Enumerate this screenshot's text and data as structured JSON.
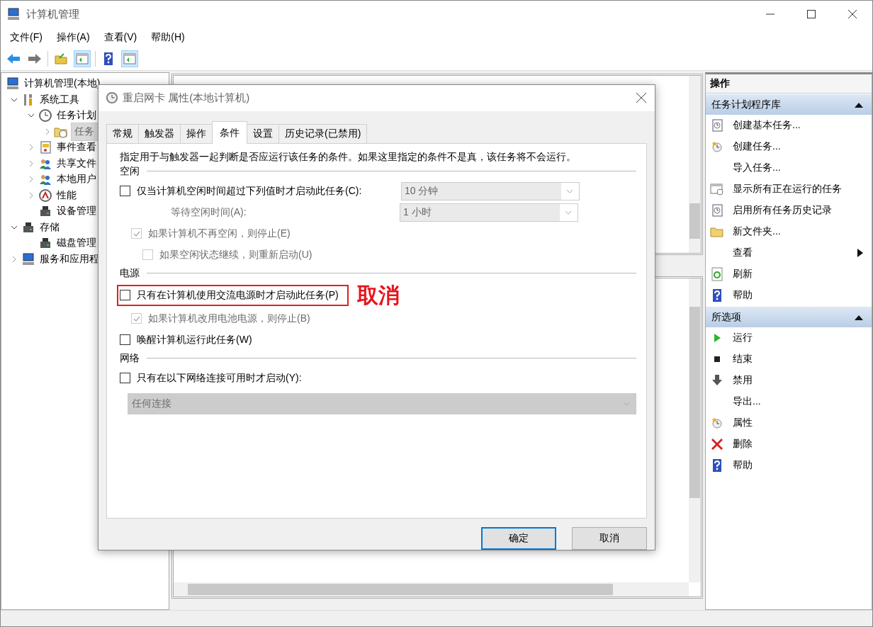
{
  "window": {
    "title": "计算机管理"
  },
  "menu": [
    "文件(F)",
    "操作(A)",
    "查看(V)",
    "帮助(H)"
  ],
  "toolbar": [
    {
      "on": false
    },
    {
      "on": false
    },
    {
      "on": false
    },
    {
      "on": true
    },
    {
      "on": false
    },
    {
      "on": true
    }
  ],
  "tree": [
    {
      "label": "计算机管理(本地)",
      "selected": false,
      "children": [
        {
          "label": "系统工具",
          "selected": false,
          "expanded": true,
          "children": [
            {
              "label": "任务计划",
              "selected": false,
              "expanded": true,
              "children": [
                {
                  "label": "任务",
                  "selected": true,
                  "expanded": false
                }
              ]
            },
            {
              "label": "事件查看",
              "selected": false,
              "expanded": false
            },
            {
              "label": "共享文件",
              "selected": false,
              "expanded": false
            },
            {
              "label": "本地用户",
              "selected": false,
              "expanded": false
            },
            {
              "label": "性能",
              "selected": false,
              "expanded": false
            },
            {
              "label": "设备管理",
              "selected": false
            }
          ]
        },
        {
          "label": "存储",
          "selected": false,
          "expanded": true,
          "children": [
            {
              "label": "磁盘管理",
              "selected": false
            }
          ]
        },
        {
          "label": "服务和应用程",
          "selected": false,
          "expanded": false
        }
      ]
    }
  ],
  "actions": {
    "title": "操作",
    "sections": [
      {
        "title": "任务计划程序库",
        "expanded": true,
        "items": [
          {
            "label": "创建基本任务...",
            "submenu": false
          },
          {
            "label": "创建任务...",
            "submenu": false
          },
          {
            "label": "导入任务...",
            "submenu": false
          },
          {
            "label": "显示所有正在运行的任务",
            "submenu": false
          },
          {
            "label": "启用所有任务历史记录",
            "submenu": false
          },
          {
            "label": "新文件夹...",
            "submenu": false
          },
          {
            "label": "查看",
            "submenu": true
          },
          {
            "label": "刷新",
            "submenu": false
          },
          {
            "label": "帮助",
            "submenu": false
          }
        ]
      },
      {
        "title": "所选项",
        "expanded": true,
        "items": [
          {
            "label": "运行",
            "submenu": false
          },
          {
            "label": "结束",
            "submenu": false
          },
          {
            "label": "禁用",
            "submenu": false
          },
          {
            "label": "导出...",
            "submenu": false
          },
          {
            "label": "属性",
            "submenu": false
          },
          {
            "label": "删除",
            "submenu": false
          },
          {
            "label": "帮助",
            "submenu": false
          }
        ]
      }
    ]
  },
  "dialog": {
    "title": "重启网卡 属性(本地计算机)",
    "tabs": [
      {
        "label": "常规",
        "selected": false
      },
      {
        "label": "触发器",
        "selected": false
      },
      {
        "label": "操作",
        "selected": false
      },
      {
        "label": "条件",
        "selected": true
      },
      {
        "label": "设置",
        "selected": false
      },
      {
        "label": "历史记录(已禁用)",
        "selected": false
      }
    ],
    "description": "指定用于与触发器一起判断是否应运行该任务的条件。如果这里指定的条件不是真，该任务将不会运行。",
    "groups": [
      {
        "heading": "空闲",
        "items": [
          {
            "kind": "checkbox",
            "label": "仅当计算机空闲时间超过下列值时才启动此任务(C):",
            "checked": false,
            "disabled": false,
            "highlighted": false,
            "select": "10 分钟",
            "children": [
              {
                "kind": "label",
                "label": "等待空闲时间(A):",
                "disabled": true,
                "select": "1 小时"
              },
              {
                "kind": "checkbox",
                "label": "如果计算机不再空闲，则停止(E)",
                "checked": true,
                "disabled": true,
                "highlighted": false,
                "children": [
                  {
                    "kind": "checkbox",
                    "label": "如果空闲状态继续，则重新启动(U)",
                    "checked": false,
                    "disabled": true,
                    "highlighted": false
                  }
                ]
              }
            ]
          }
        ]
      },
      {
        "heading": "电源",
        "items": [
          {
            "kind": "checkbox",
            "label": "只有在计算机使用交流电源时才启动此任务(P)",
            "checked": false,
            "disabled": false,
            "highlighted": true,
            "annotation": "取消",
            "children": [
              {
                "kind": "checkbox",
                "label": "如果计算机改用电池电源，则停止(B)",
                "checked": true,
                "disabled": true,
                "highlighted": false
              }
            ]
          },
          {
            "kind": "checkbox",
            "label": "唤醒计算机运行此任务(W)",
            "checked": false,
            "disabled": false,
            "highlighted": false
          }
        ]
      },
      {
        "heading": "网络",
        "items": [
          {
            "kind": "checkbox",
            "label": "只有在以下网络连接可用时才启动(Y):",
            "checked": false,
            "disabled": false,
            "highlighted": false
          },
          {
            "kind": "wideselect",
            "value": "任何连接",
            "disabled": true
          }
        ]
      }
    ],
    "buttons": [
      {
        "label": "确定",
        "default": true
      },
      {
        "label": "取消",
        "default": false
      }
    ]
  }
}
